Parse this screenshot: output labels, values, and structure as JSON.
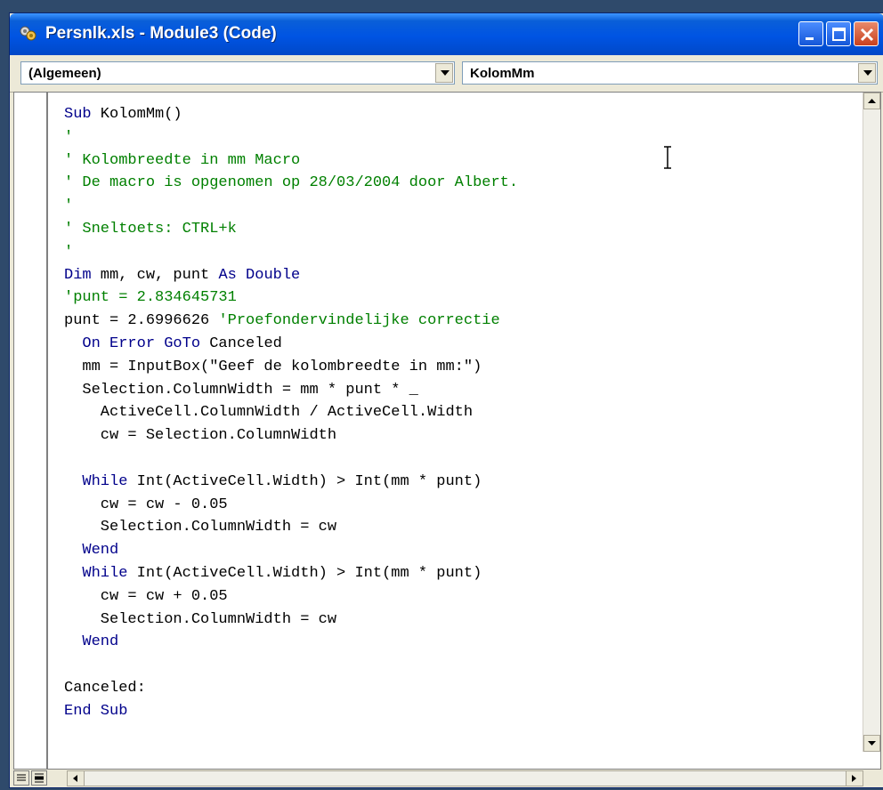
{
  "window": {
    "title": "Persnlk.xls - Module3 (Code)",
    "title_color": "#ffffff",
    "titlebar_color": "#0054e3"
  },
  "combos": {
    "object": "(Algemeen)",
    "procedure": "KolomMm"
  },
  "code": {
    "comment_color": "#008000",
    "keyword_color": "#00008b",
    "lines": [
      {
        "parts": [
          {
            "t": "kw",
            "v": "Sub"
          },
          {
            "t": "txt",
            "v": " KolomMm()"
          }
        ]
      },
      {
        "parts": [
          {
            "t": "cmt",
            "v": "'"
          }
        ]
      },
      {
        "parts": [
          {
            "t": "cmt",
            "v": "' Kolombreedte in mm Macro"
          }
        ]
      },
      {
        "parts": [
          {
            "t": "cmt",
            "v": "' De macro is opgenomen op 28/03/2004 door Albert."
          }
        ]
      },
      {
        "parts": [
          {
            "t": "cmt",
            "v": "'"
          }
        ]
      },
      {
        "parts": [
          {
            "t": "cmt",
            "v": "' Sneltoets: CTRL+k"
          }
        ]
      },
      {
        "parts": [
          {
            "t": "cmt",
            "v": "'"
          }
        ]
      },
      {
        "parts": [
          {
            "t": "kw",
            "v": "Dim"
          },
          {
            "t": "txt",
            "v": " mm, cw, punt "
          },
          {
            "t": "kw",
            "v": "As Double"
          }
        ]
      },
      {
        "parts": [
          {
            "t": "cmt",
            "v": "'punt = 2.834645731"
          }
        ]
      },
      {
        "parts": [
          {
            "t": "txt",
            "v": "punt = 2.6996626 "
          },
          {
            "t": "cmt",
            "v": "'Proefondervindelijke correctie"
          }
        ]
      },
      {
        "parts": [
          {
            "t": "txt",
            "v": "  "
          },
          {
            "t": "kw",
            "v": "On Error GoTo"
          },
          {
            "t": "txt",
            "v": " Canceled"
          }
        ]
      },
      {
        "parts": [
          {
            "t": "txt",
            "v": "  mm = InputBox(\"Geef de kolombreedte in mm:\")"
          }
        ]
      },
      {
        "parts": [
          {
            "t": "txt",
            "v": "  Selection.ColumnWidth = mm * punt * _"
          }
        ]
      },
      {
        "parts": [
          {
            "t": "txt",
            "v": "    ActiveCell.ColumnWidth / ActiveCell.Width"
          }
        ]
      },
      {
        "parts": [
          {
            "t": "txt",
            "v": "    cw = Selection.ColumnWidth"
          }
        ]
      },
      {
        "parts": [
          {
            "t": "txt",
            "v": ""
          }
        ]
      },
      {
        "parts": [
          {
            "t": "txt",
            "v": "  "
          },
          {
            "t": "kw",
            "v": "While"
          },
          {
            "t": "txt",
            "v": " Int(ActiveCell.Width) > Int(mm * punt)"
          }
        ]
      },
      {
        "parts": [
          {
            "t": "txt",
            "v": "    cw = cw - 0.05"
          }
        ]
      },
      {
        "parts": [
          {
            "t": "txt",
            "v": "    Selection.ColumnWidth = cw"
          }
        ]
      },
      {
        "parts": [
          {
            "t": "txt",
            "v": "  "
          },
          {
            "t": "kw",
            "v": "Wend"
          }
        ]
      },
      {
        "parts": [
          {
            "t": "txt",
            "v": "  "
          },
          {
            "t": "kw",
            "v": "While"
          },
          {
            "t": "txt",
            "v": " Int(ActiveCell.Width) > Int(mm * punt)"
          }
        ]
      },
      {
        "parts": [
          {
            "t": "txt",
            "v": "    cw = cw + 0.05"
          }
        ]
      },
      {
        "parts": [
          {
            "t": "txt",
            "v": "    Selection.ColumnWidth = cw"
          }
        ]
      },
      {
        "parts": [
          {
            "t": "txt",
            "v": "  "
          },
          {
            "t": "kw",
            "v": "Wend"
          }
        ]
      },
      {
        "parts": [
          {
            "t": "txt",
            "v": ""
          }
        ]
      },
      {
        "parts": [
          {
            "t": "txt",
            "v": "Canceled:"
          }
        ]
      },
      {
        "parts": [
          {
            "t": "kw",
            "v": "End Sub"
          }
        ]
      }
    ]
  },
  "icons": {
    "app": "vba-module-icon",
    "minimize": "minimize-icon",
    "maximize": "maximize-icon",
    "close": "close-icon",
    "dropdown": "dropdown-arrow-icon",
    "cursor": "text-cursor-icon"
  }
}
